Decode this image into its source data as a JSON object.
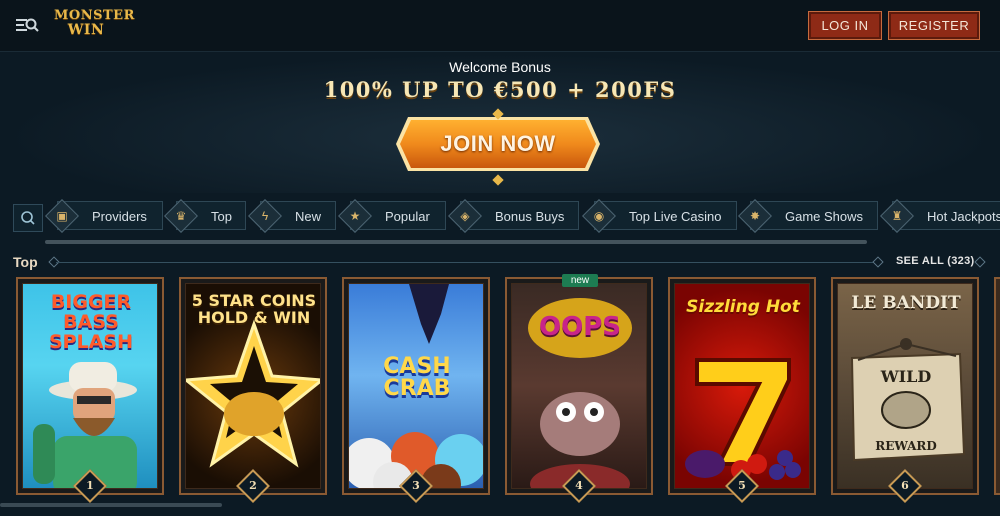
{
  "header": {
    "menu_icon": "menu-search-icon",
    "logo_line1": "MONSTER",
    "logo_line2": "WIN",
    "login_label": "LOG IN",
    "register_label": "REGISTER"
  },
  "hero": {
    "welcome": "Welcome Bonus",
    "bonus": "100% UP TO €500 + 200FS",
    "join_label": "JOIN NOW"
  },
  "filters": {
    "search_icon": "search-icon",
    "chips": [
      {
        "label": "Providers",
        "icon": "box-icon"
      },
      {
        "label": "Top",
        "icon": "crown-icon"
      },
      {
        "label": "New",
        "icon": "lightning-icon"
      },
      {
        "label": "Popular",
        "icon": "star-icon"
      },
      {
        "label": "Bonus Buys",
        "icon": "cube-icon"
      },
      {
        "label": "Top Live Casino",
        "icon": "chip-icon"
      },
      {
        "label": "Game Shows",
        "icon": "sparkle-icon"
      },
      {
        "label": "Hot Jackpots",
        "icon": "bell-icon"
      }
    ]
  },
  "section": {
    "title": "Top",
    "see_all": "SEE ALL (323)"
  },
  "games": [
    {
      "title": "BIGGER BASS SPLASH",
      "rank": "1"
    },
    {
      "title": "5 STAR COINS HOLD & WIN",
      "rank": "2"
    },
    {
      "title": "CASH CRAB",
      "rank": "3"
    },
    {
      "title": "OOPS",
      "rank": "4",
      "badge": "new"
    },
    {
      "title": "Sizzling Hot",
      "rank": "5"
    },
    {
      "title": "LE BANDIT",
      "rank": "6"
    }
  ],
  "colors": {
    "accent": "#e8b84a",
    "button_red": "#8e2a16",
    "join_orange": "#f08a1c"
  }
}
